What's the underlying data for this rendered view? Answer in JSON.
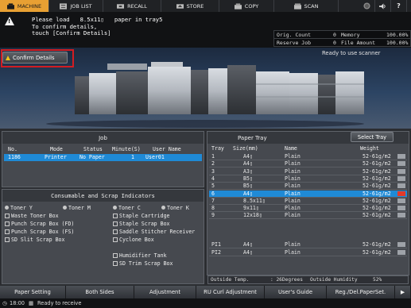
{
  "tabs": [
    {
      "label": "MACHINE",
      "icon": "machine-icon",
      "active": true
    },
    {
      "label": "JOB LIST",
      "icon": "job-list-icon",
      "active": false
    },
    {
      "label": "RECALL",
      "icon": "recall-icon",
      "active": false
    },
    {
      "label": "STORE",
      "icon": "store-icon",
      "active": false
    },
    {
      "label": "COPY",
      "icon": "copy-icon",
      "active": false
    },
    {
      "label": "SCAN",
      "icon": "scan-icon",
      "active": false
    }
  ],
  "tab_icons": {
    "globe": "globe-icon",
    "volume": "volume-icon",
    "help": "help-icon"
  },
  "message": {
    "line1": "Please load   8.5x11▯   paper in tray5",
    "line2": "To confirm details,",
    "line3": "touch [Confirm Details]"
  },
  "counters": {
    "orig_count_label": "Orig. Count",
    "orig_count_value": "0",
    "memory_label": "Memory",
    "memory_value": "100.00%",
    "reserve_job_label": "Reserve Job",
    "reserve_job_value": "0",
    "file_amount_label": "File Amount",
    "file_amount_value": "100.00%"
  },
  "confirm_details_label": "Confirm Details",
  "status_ready_scanner": "Ready to use scanner",
  "job_panel": {
    "title": "Job",
    "columns": {
      "no": "No.",
      "mode": "Mode",
      "status": "Status",
      "minute": "Minute(S)",
      "user": "User Name"
    },
    "rows": [
      {
        "no": "1186",
        "mode": "Printer",
        "status": "No Paper",
        "minute": "1",
        "user": "User01"
      }
    ]
  },
  "consumables": {
    "title": "Consumable and Scrap Indicators",
    "left": [
      "Toner Y",
      "Toner M",
      "Waste Toner Box",
      "Punch Scrap Box (FD)",
      "Punch Scrap Box (FS)",
      "SD Slit Scrap Box"
    ],
    "right": [
      "Toner C",
      "Toner K",
      "Staple Cartridge",
      "Staple Scrap Box",
      "Saddle Stitcher Receiver",
      "Cyclone Box",
      "Humidifier Tank",
      "SD Trim Scrap Box"
    ]
  },
  "paper_tray": {
    "title": "Paper Tray",
    "select_tray_label": "Select Tray",
    "columns": {
      "tray": "Tray",
      "size": "Size(mm)",
      "name": "Name",
      "weight": "Weight"
    },
    "rows": [
      {
        "tray": "1",
        "size": "A4▯",
        "name": "Plain",
        "weight": "52-61g/m2",
        "selected": false
      },
      {
        "tray": "2",
        "size": "A4▯",
        "name": "Plain",
        "weight": "52-61g/m2",
        "selected": false
      },
      {
        "tray": "3",
        "size": "A3▯",
        "name": "Plain",
        "weight": "52-61g/m2",
        "selected": false
      },
      {
        "tray": "4",
        "size": "B5▯",
        "name": "Plain",
        "weight": "52-61g/m2",
        "selected": false
      },
      {
        "tray": "5",
        "size": "B5▯",
        "name": "Plain",
        "weight": "52-61g/m2",
        "selected": false
      },
      {
        "tray": "6",
        "size": "A4▯",
        "name": "Plain",
        "weight": "52-61g/m2",
        "selected": true
      },
      {
        "tray": "7",
        "size": "8.5x11▯",
        "name": "Plain",
        "weight": "52-61g/m2",
        "selected": false
      },
      {
        "tray": "8",
        "size": "9x11▯",
        "name": "Plain",
        "weight": "52-61g/m2",
        "selected": false
      },
      {
        "tray": "9",
        "size": "12x18▯",
        "name": "Plain",
        "weight": "52-61g/m2",
        "selected": false
      }
    ],
    "pi_rows": [
      {
        "tray": "PI1",
        "size": "A4▯",
        "name": "Plain",
        "weight": "52-61g/m2"
      },
      {
        "tray": "PI2",
        "size": "A4▯",
        "name": "Plain",
        "weight": "52-61g/m2"
      }
    ],
    "outside_temp_label": "Outside Temp.",
    "outside_temp_value": ": 26Degrees",
    "outside_humidity_label": "Outside Humidity",
    "outside_humidity_value": "52%"
  },
  "bottom_buttons": [
    "Paper Setting",
    "Both Sides",
    "Adjustment",
    "RU Curl Adjustment",
    "User's Guide",
    "Reg./Del.PaperSet."
  ],
  "status_bar": {
    "time": "18:00",
    "message": "Ready to receive"
  },
  "colors": {
    "accent": "#e8a033",
    "selected_row": "#1f8ad6",
    "alert_border": "#d21d22"
  }
}
